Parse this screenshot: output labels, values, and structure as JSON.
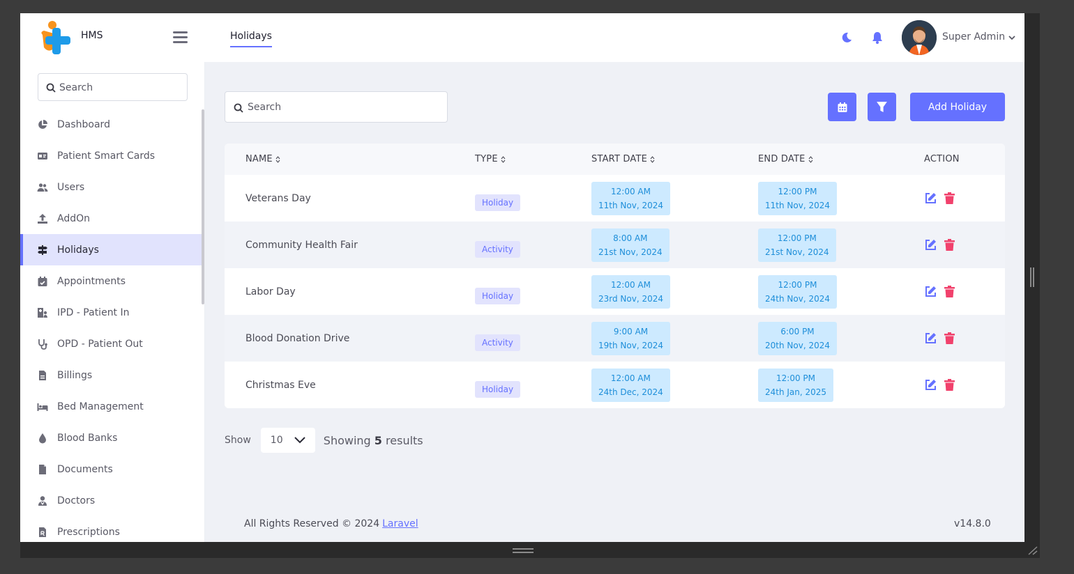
{
  "app": {
    "brand": "HMS",
    "page_tab": "Holidays"
  },
  "colors": {
    "accent": "#6571ff",
    "danger": "#f1416c",
    "info_bg": "#cdeaff",
    "info_text": "#1e8ed9"
  },
  "header": {
    "user_name": "Super Admin",
    "icons": [
      "moon-icon",
      "bell-icon",
      "chevron-down-icon"
    ]
  },
  "sidebar": {
    "search_placeholder": "Search",
    "items": [
      {
        "label": "Dashboard",
        "icon": "pie-chart-icon"
      },
      {
        "label": "Patient Smart Cards",
        "icon": "id-card-icon"
      },
      {
        "label": "Users",
        "icon": "users-icon"
      },
      {
        "label": "AddOn",
        "icon": "upload-icon"
      },
      {
        "label": "Holidays",
        "icon": "signpost-icon",
        "active": true
      },
      {
        "label": "Appointments",
        "icon": "calendar-check-icon"
      },
      {
        "label": "IPD - Patient In",
        "icon": "hospital-user-icon"
      },
      {
        "label": "OPD - Patient Out",
        "icon": "stethoscope-icon"
      },
      {
        "label": "Billings",
        "icon": "invoice-icon"
      },
      {
        "label": "Bed Management",
        "icon": "bed-icon"
      },
      {
        "label": "Blood Banks",
        "icon": "blood-drop-icon"
      },
      {
        "label": "Documents",
        "icon": "file-icon"
      },
      {
        "label": "Doctors",
        "icon": "doctor-icon"
      },
      {
        "label": "Prescriptions",
        "icon": "prescription-icon"
      }
    ]
  },
  "toolbar": {
    "search_placeholder": "Search",
    "add_label": "Add Holiday"
  },
  "table": {
    "columns": [
      "NAME",
      "TYPE",
      "START DATE",
      "END DATE",
      "ACTION"
    ],
    "rows": [
      {
        "name": "Veterans Day",
        "type": "Holiday",
        "start_time": "12:00 AM",
        "start_date": "11th Nov, 2024",
        "end_time": "12:00 PM",
        "end_date": "11th Nov, 2024"
      },
      {
        "name": "Community Health Fair",
        "type": "Activity",
        "start_time": "8:00 AM",
        "start_date": "21st Nov, 2024",
        "end_time": "12:00 PM",
        "end_date": "21st Nov, 2024"
      },
      {
        "name": "Labor Day",
        "type": "Holiday",
        "start_time": "12:00 AM",
        "start_date": "23rd Nov, 2024",
        "end_time": "12:00 PM",
        "end_date": "24th Nov, 2024"
      },
      {
        "name": "Blood Donation Drive",
        "type": "Activity",
        "start_time": "9:00 AM",
        "start_date": "19th Nov, 2024",
        "end_time": "6:00 PM",
        "end_date": "20th Nov, 2024"
      },
      {
        "name": "Christmas Eve",
        "type": "Holiday",
        "start_time": "12:00 AM",
        "start_date": "24th Dec, 2024",
        "end_time": "12:00 PM",
        "end_date": "24th Jan, 2025"
      }
    ]
  },
  "pagination": {
    "show_label": "Show",
    "page_size": "10",
    "results_prefix": "Showing",
    "results_count": "5",
    "results_suffix": "results"
  },
  "footer": {
    "rights": "All Rights Reserved © 2024",
    "link": "Laravel",
    "version": "v14.8.0"
  }
}
